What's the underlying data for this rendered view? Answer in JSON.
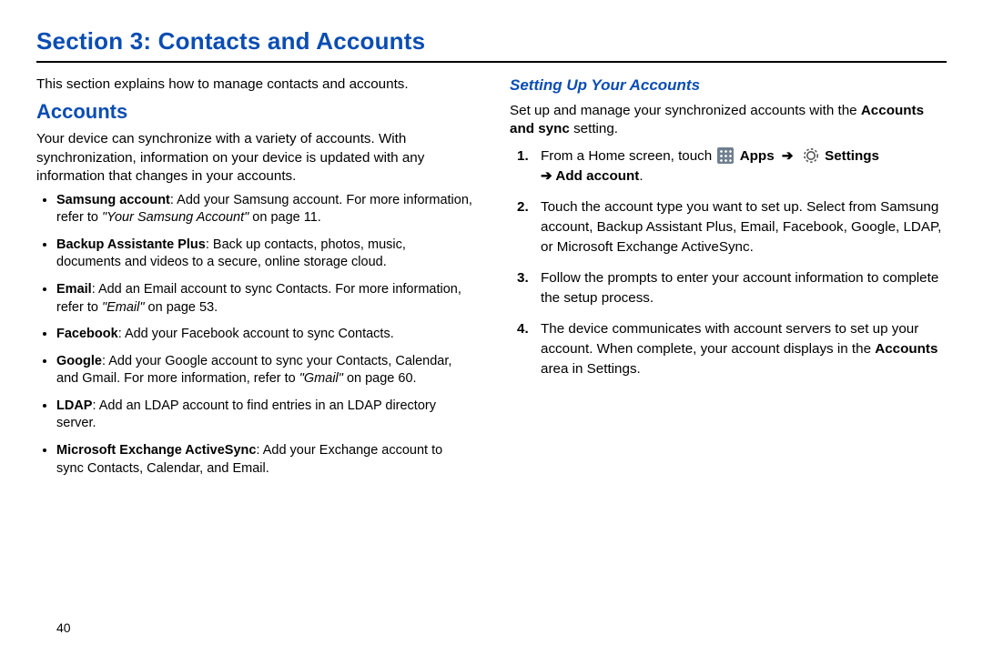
{
  "title": "Section 3: Contacts and Accounts",
  "intro": "This section explains how to manage contacts and accounts.",
  "left": {
    "heading": "Accounts",
    "lead": "Your device can synchronize with a variety of accounts. With synchronization, information on your device is updated with any information that changes in your accounts.",
    "bullets": [
      {
        "b": "Samsung account",
        "after": ": Add your Samsung account. For more information, refer to ",
        "ref": "\"Your Samsung Account\"",
        "page": " on page 11."
      },
      {
        "b": "Backup Assistante Plus",
        "after": ": Back up contacts, photos, music, documents and videos to a secure, online storage cloud."
      },
      {
        "b": "Email",
        "after": ": Add an Email account to sync Contacts. For more information, refer to ",
        "ref": "\"Email\"",
        "page": " on page 53."
      },
      {
        "b": "Facebook",
        "after": ": Add your Facebook account to sync Contacts."
      },
      {
        "b": "Google",
        "after": ": Add your Google account to sync your Contacts, Calendar, and Gmail. For more information, refer to ",
        "ref": "\"Gmail\"",
        "page": " on page 60."
      },
      {
        "b": "LDAP",
        "after": ": Add an LDAP account to find entries in an LDAP directory server."
      },
      {
        "b": "Microsoft Exchange ActiveSync",
        "after": ": Add your Exchange account to sync Contacts, Calendar, and Email."
      }
    ]
  },
  "right": {
    "subheading": "Setting Up Your Accounts",
    "lead1": "Set up and manage your synchronized accounts with the ",
    "lead1b": "Accounts and sync",
    "lead1c": " setting.",
    "step1": {
      "a": "From a Home screen, touch ",
      "apps": "Apps",
      "arrow": "➔",
      "settings": "Settings",
      "b": "➔ Add account",
      "c": "."
    },
    "step2": "Touch the account type you want to set up. Select from Samsung account, Backup Assistant Plus, Email, Facebook, Google, LDAP, or Microsoft Exchange ActiveSync.",
    "step3": "Follow the prompts to enter your account information to complete the setup process.",
    "step4a": "The device communicates with account servers to set up your account. When complete, your account displays in the ",
    "step4b": "Accounts",
    "step4c": " area in Settings."
  },
  "pagenum": "40"
}
